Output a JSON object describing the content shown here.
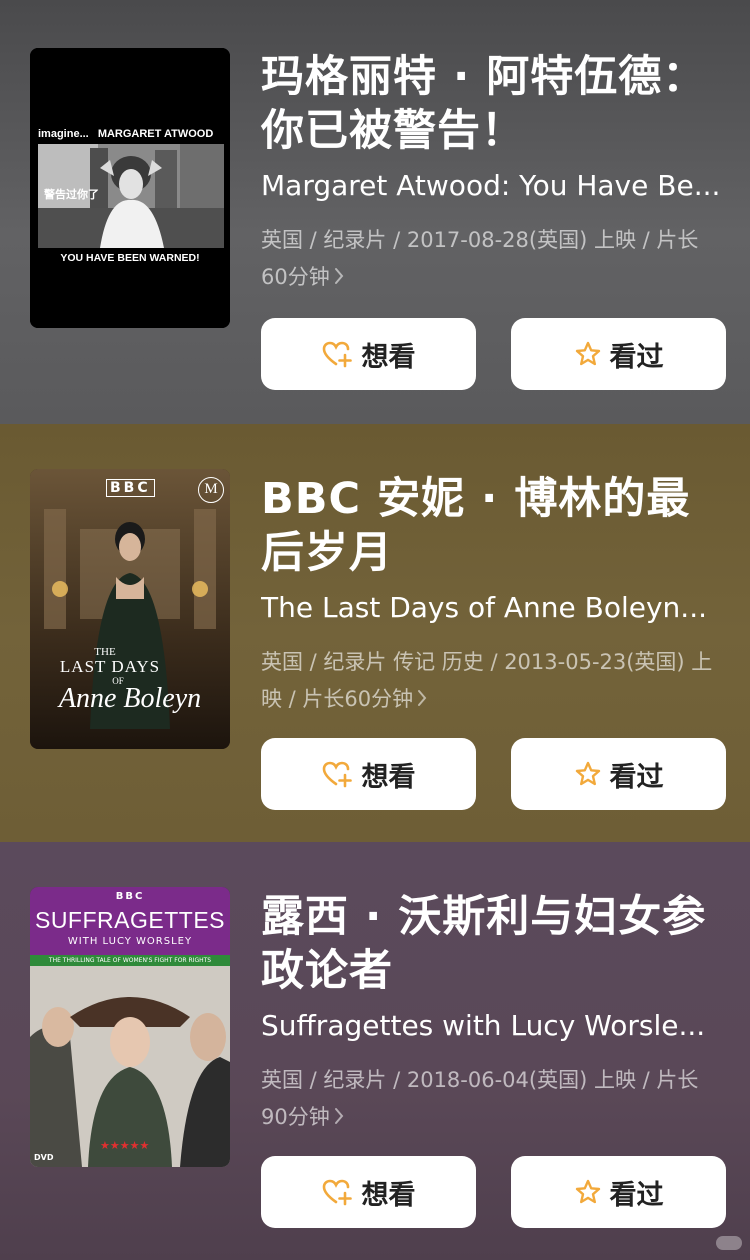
{
  "accent_color": "#f2a93b",
  "movies": [
    {
      "title_cn": "玛格丽特 · 阿特伍德：你已被警告！",
      "title_en": "Margaret Atwood: You Have Be...",
      "meta": "英国 / 纪录片 / 2017-08-28(英国) 上映 / 片长60分钟",
      "want_label": "想看",
      "seen_label": "看过",
      "poster": {
        "top_text_prefix": "imagine...",
        "top_text": "MARGARET ATWOOD",
        "mid_text": "警告过你了",
        "bottom_text": "YOU HAVE BEEN WARNED!"
      }
    },
    {
      "title_cn": "BBC 安妮 · 博林的最后岁月",
      "title_en": "The Last Days of Anne Boleyn...",
      "meta": "英国 / 纪录片 传记 历史 / 2013-05-23(英国) 上映 / 片长60分钟",
      "want_label": "想看",
      "seen_label": "看过",
      "poster": {
        "brand": "BBC",
        "badge": "M",
        "line1": "THE",
        "line2": "LAST DAYS",
        "line3": "OF",
        "line4": "Anne Boleyn"
      }
    },
    {
      "title_cn": "露西 · 沃斯利与妇女参政论者",
      "title_en": "Suffragettes with Lucy Worsle...",
      "meta": "英国 / 纪录片 / 2018-06-04(英国) 上映 / 片长90分钟",
      "want_label": "想看",
      "seen_label": "看过",
      "poster": {
        "brand": "BBC",
        "title": "SUFFRAGETTES",
        "subtitle": "WITH LUCY WORSLEY",
        "tagline": "THE THRILLING TALE OF WOMEN'S FIGHT FOR RIGHTS",
        "stars": "★★★★★",
        "dvd": "DVD"
      }
    }
  ]
}
